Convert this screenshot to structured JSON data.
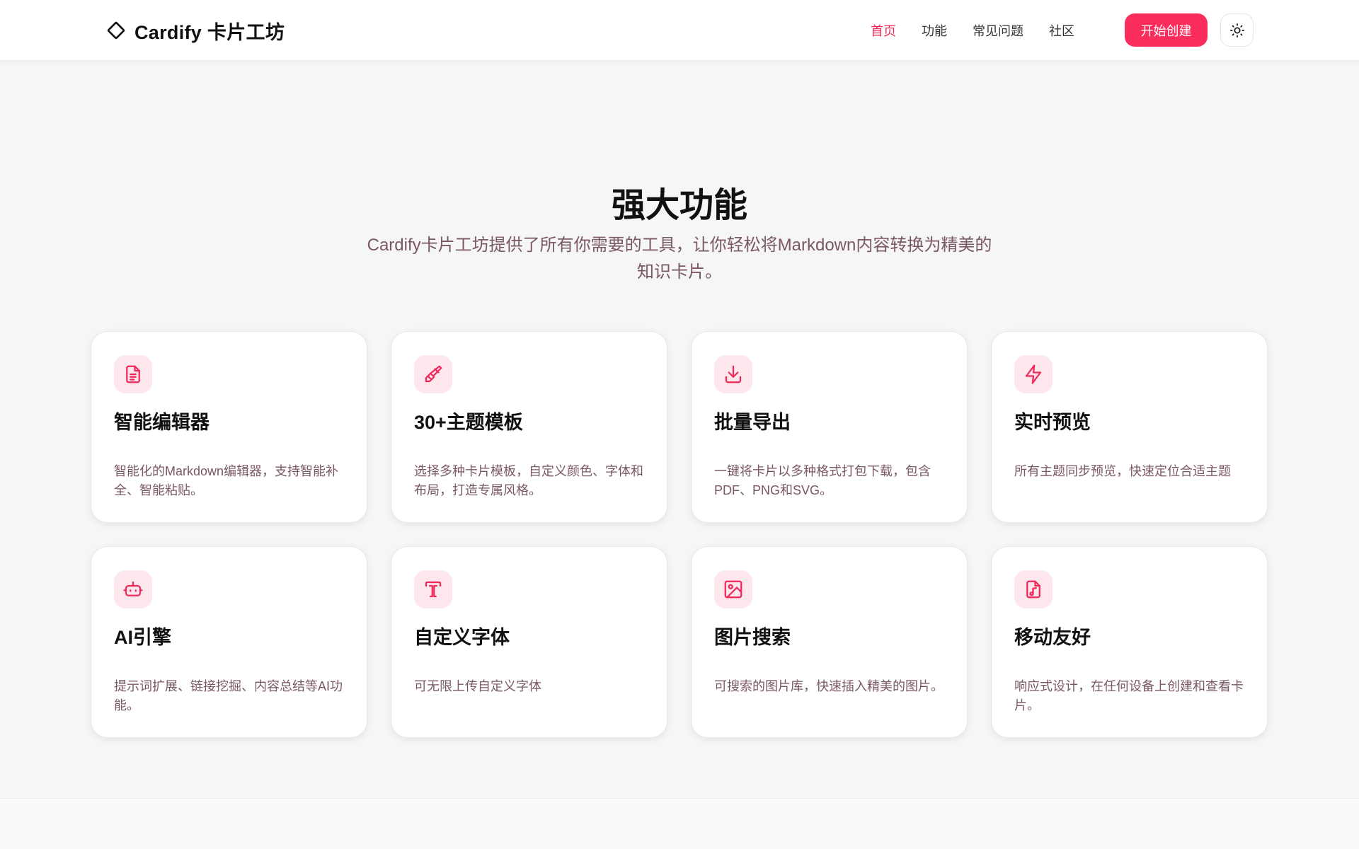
{
  "header": {
    "logo_text": "Cardify 卡片工坊",
    "nav": [
      {
        "label": "首页",
        "active": true
      },
      {
        "label": "功能",
        "active": false
      },
      {
        "label": "常见问题",
        "active": false
      },
      {
        "label": "社区",
        "active": false
      }
    ],
    "cta_label": "开始创建",
    "theme_icon": "sun-icon"
  },
  "section": {
    "title": "强大功能",
    "subtitle": "Cardify卡片工坊提供了所有你需要的工具，让你轻松将Markdown内容转换为精美的知识卡片。"
  },
  "features": [
    {
      "icon": "document-icon",
      "title": "智能编辑器",
      "desc": "智能化的Markdown编辑器，支持智能补全、智能粘贴。"
    },
    {
      "icon": "paintbrush-icon",
      "title": "30+主题模板",
      "desc": "选择多种卡片模板，自定义颜色、字体和布局，打造专属风格。"
    },
    {
      "icon": "download-icon",
      "title": "批量导出",
      "desc": "一键将卡片以多种格式打包下载，包含PDF、PNG和SVG。"
    },
    {
      "icon": "lightning-icon",
      "title": "实时预览",
      "desc": "所有主题同步预览，快速定位合适主题"
    },
    {
      "icon": "robot-icon",
      "title": "AI引擎",
      "desc": "提示词扩展、链接挖掘、内容总结等AI功能。"
    },
    {
      "icon": "type-icon",
      "title": "自定义字体",
      "desc": "可无限上传自定义字体"
    },
    {
      "icon": "image-icon",
      "title": "图片搜索",
      "desc": "可搜索的图片库，快速插入精美的图片。"
    },
    {
      "icon": "music-file-icon",
      "title": "移动友好",
      "desc": "响应式设计，在任何设备上创建和查看卡片。"
    }
  ],
  "colors": {
    "accent": "#fb2d5d",
    "icon_bg": "#fde7ec",
    "muted_text": "#7a5860"
  }
}
